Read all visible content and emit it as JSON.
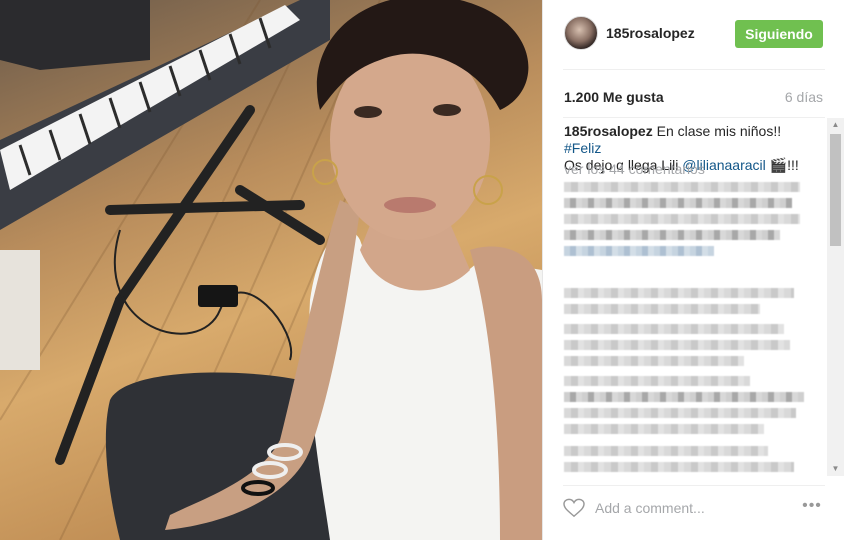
{
  "post": {
    "username": "185rosalopez",
    "follow_button": "Siguiendo",
    "likes": "1.200 Me gusta",
    "age": "6 días",
    "caption": {
      "user": "185rosalopez",
      "text_1": "En clase mis niños!! ",
      "hashtag": "#Feliz",
      "text_2": "Os dejo q llega Lili ",
      "mention": "@lilianaaracil",
      "text_3": " 🎬!!!"
    },
    "view_all_comments": "ver los 44 comentarios",
    "comment_placeholder": "Add a comment...",
    "more_label": "•••"
  },
  "colors": {
    "follow_green": "#70c050",
    "link_blue": "#125688",
    "muted_gray": "#a5a7aa"
  },
  "icons": {
    "heart": "heart-outline-icon",
    "more": "more-options-icon"
  }
}
